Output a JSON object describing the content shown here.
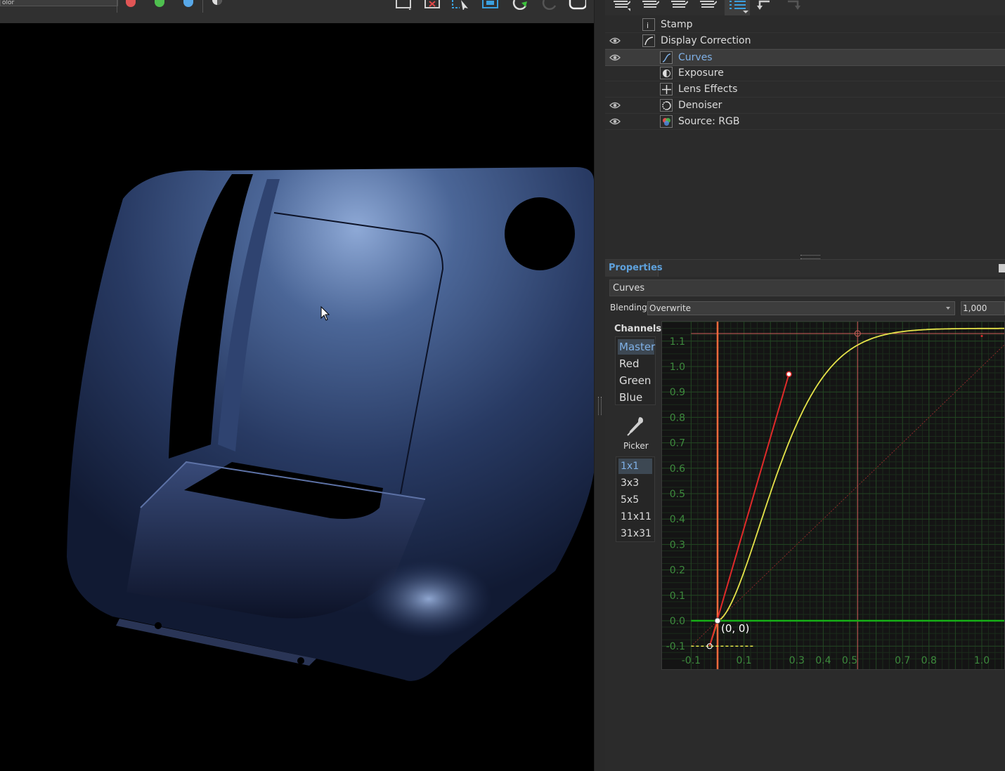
{
  "viewport_toolbar": {
    "combo_text": "olor",
    "color_dots": [
      {
        "name": "red-channel-dot",
        "color": "#e05555"
      },
      {
        "name": "green-channel-dot",
        "color": "#4fbf4f"
      },
      {
        "name": "blue-channel-dot",
        "color": "#58a8e8"
      }
    ],
    "icons": [
      "contrast-icon",
      "save-region-icon",
      "close-region-icon",
      "pick-region-icon",
      "fit-region-icon",
      "refresh-icon",
      "refresh-disabled-icon",
      "clear-icon"
    ]
  },
  "layers_toolbar": {
    "icons": [
      "layer-stack-icon",
      "layer-stack-icon",
      "layer-stack-icon",
      "layer-stack-icon",
      "list-menu-icon",
      "undo-icon",
      "redo-icon"
    ]
  },
  "layers": [
    {
      "label": "Stamp",
      "visible_eye": false,
      "indent": 1,
      "icon": "stamp-icon",
      "selected": false
    },
    {
      "label": "Display Correction",
      "visible_eye": true,
      "indent": 1,
      "icon": "display-correction-icon",
      "selected": false
    },
    {
      "label": "Curves",
      "visible_eye": true,
      "indent": 2,
      "icon": "curves-icon",
      "selected": true
    },
    {
      "label": "Exposure",
      "visible_eye": false,
      "indent": 2,
      "icon": "exposure-icon",
      "selected": false
    },
    {
      "label": "Lens Effects",
      "visible_eye": false,
      "indent": 2,
      "icon": "lens-effects-icon",
      "selected": false
    },
    {
      "label": "Denoiser",
      "visible_eye": true,
      "indent": 2,
      "icon": "denoiser-icon",
      "selected": false
    },
    {
      "label": "Source: RGB",
      "visible_eye": true,
      "indent": 2,
      "icon": "source-rgb-icon",
      "selected": false
    }
  ],
  "properties": {
    "tab_label": "Properties",
    "node_name": "Curves",
    "blending_label": "Blending",
    "blending_value": "Overwrite",
    "opacity_value": "1,000",
    "channels_title": "Channels",
    "channels": [
      "Master",
      "Red",
      "Green",
      "Blue"
    ],
    "active_channel": "Master",
    "picker_label": "Picker",
    "picker_sizes": [
      "1x1",
      "3x3",
      "5x5",
      "11x11",
      "31x31"
    ],
    "active_picker_size": "1x1"
  },
  "curve_editor": {
    "point_label": "(0, 0)",
    "y_ticks": [
      "1.1",
      "1.0",
      "0.9",
      "0.8",
      "0.7",
      "0.6",
      "0.5",
      "0.4",
      "0.3",
      "0.2",
      "0.1",
      "0.0",
      "-0.1"
    ],
    "x_ticks": [
      "-0.1",
      "0.1",
      "0.3",
      "0.4",
      "0.5",
      "0.7",
      "0.8",
      "1.0",
      "1"
    ],
    "colors": {
      "curve": "#e6e34a",
      "tangent": "#e02a2a",
      "guide": "#d0605a",
      "baseline": "#16b016",
      "grid": "#224422",
      "tick_text": "#3d8a3d"
    }
  }
}
